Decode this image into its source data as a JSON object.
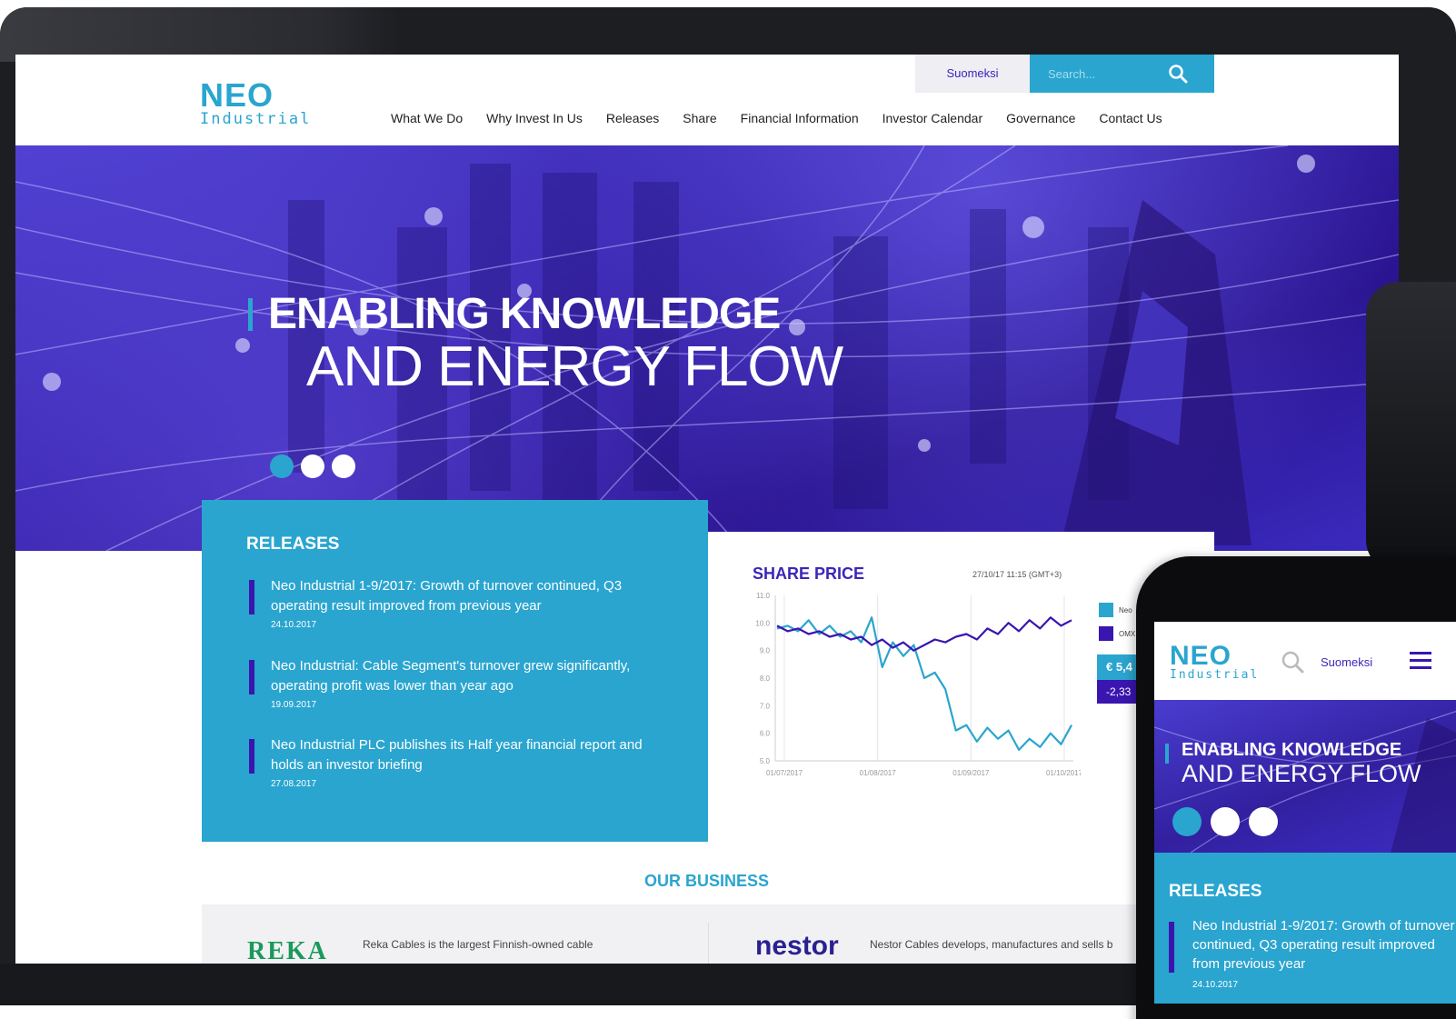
{
  "header": {
    "logo_top": "NEO",
    "logo_bottom": "Industrial",
    "language": "Suomeksi",
    "search_placeholder": "Search...",
    "nav": [
      "What We Do",
      "Why Invest In Us",
      "Releases",
      "Share",
      "Financial Information",
      "Investor Calendar",
      "Governance",
      "Contact Us"
    ]
  },
  "hero": {
    "line1": "ENABLING KNOWLEDGE",
    "line2": "AND ENERGY FLOW",
    "slides": 3,
    "active_slide": 1
  },
  "releases": {
    "title": "RELEASES",
    "items": [
      {
        "text": "Neo Industrial 1-9/2017: Growth of turnover continued, Q3 operating result improved from previous year",
        "date": "24.10.2017"
      },
      {
        "text": "Neo Industrial: Cable Segment's turnover grew significantly, operating profit was lower than year ago",
        "date": "19.09.2017"
      },
      {
        "text": "Neo Industrial PLC publishes its Half year financial report and holds an investor briefing",
        "date": "27.08.2017"
      }
    ]
  },
  "share": {
    "title": "SHARE PRICE",
    "timestamp": "27/10/17 11:15 (GMT+3)",
    "legend": [
      "Neo",
      "OMX"
    ],
    "price": "€ 5,4",
    "change": "-2,33"
  },
  "chart_data": {
    "type": "line",
    "x_ticks": [
      "01/07/2017",
      "01/08/2017",
      "01/09/2017",
      "01/10/2017"
    ],
    "y_ticks": [
      11.0,
      10.0,
      9.0,
      8.0,
      7.0,
      6.0,
      5.0
    ],
    "ylim": [
      5.0,
      11.0
    ],
    "series": [
      {
        "name": "Neo",
        "color": "#2aa5cf",
        "values": [
          9.8,
          9.9,
          9.7,
          10.1,
          9.6,
          9.9,
          9.5,
          9.7,
          9.3,
          10.2,
          8.4,
          9.3,
          8.8,
          9.2,
          8.0,
          8.2,
          7.6,
          6.1,
          6.3,
          5.7,
          6.2,
          5.8,
          6.1,
          5.4,
          5.8,
          5.5,
          6.0,
          5.6,
          6.3
        ]
      },
      {
        "name": "OMX",
        "color": "#3a15b0",
        "values": [
          9.9,
          9.7,
          9.8,
          9.6,
          9.7,
          9.5,
          9.6,
          9.4,
          9.5,
          9.2,
          9.4,
          9.1,
          9.3,
          9.0,
          9.2,
          9.4,
          9.3,
          9.5,
          9.6,
          9.4,
          9.8,
          9.6,
          10.0,
          9.7,
          10.1,
          9.8,
          10.2,
          9.9,
          10.1
        ]
      }
    ]
  },
  "business": {
    "title": "OUR BUSINESS",
    "reka_logo": "REKA",
    "reka_text": "Reka Cables is the largest Finnish-owned cable",
    "nestor_logo": "nestor",
    "nestor_text": "Nestor Cables develops, manufactures and sells b"
  },
  "phone": {
    "language": "Suomeksi",
    "hero_line1": "ENABLING KNOWLEDGE",
    "hero_line2": "AND ENERGY FLOW",
    "releases_title": "RELEASES",
    "release_text": "Neo Industrial 1-9/2017: Growth of turnover continued, Q3 operating result improved from previous year",
    "release_date": "24.10.2017"
  },
  "colors": {
    "accent": "#2aa5cf",
    "brand_purple": "#3a15b0",
    "hero": "#3420a8"
  }
}
